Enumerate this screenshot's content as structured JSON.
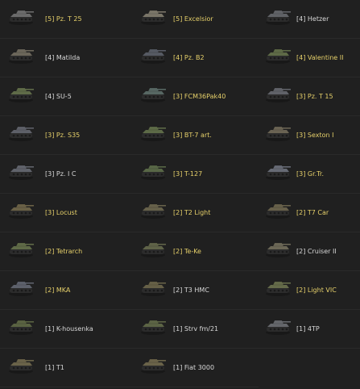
{
  "colors": {
    "background": "#202020",
    "premium_text": "#e6d06a",
    "standard_text": "#d8d8d8"
  },
  "tanks": [
    {
      "label": "[5] Pz. T 25",
      "premium": true,
      "icon": "tank-icon",
      "tint": "#6b6b6b"
    },
    {
      "label": "[5] Excelsior",
      "premium": true,
      "icon": "tank-icon",
      "tint": "#7a7568"
    },
    {
      "label": "[4] Hetzer",
      "premium": false,
      "icon": "tank-icon",
      "tint": "#606266"
    },
    {
      "label": "[4] Matilda",
      "premium": false,
      "icon": "tank-icon",
      "tint": "#6b665a"
    },
    {
      "label": "[4] Pz. B2",
      "premium": true,
      "icon": "tank-icon",
      "tint": "#565a63"
    },
    {
      "label": "[4] Valentine II",
      "premium": true,
      "icon": "tank-icon",
      "tint": "#5e6a47"
    },
    {
      "label": "[4] SU-5",
      "premium": false,
      "icon": "tank-icon",
      "tint": "#5f6b48"
    },
    {
      "label": "[3] FCM36Pak40",
      "premium": true,
      "icon": "tank-icon",
      "tint": "#576763"
    },
    {
      "label": "[3] Pz. T 15",
      "premium": true,
      "icon": "tank-icon",
      "tint": "#606268"
    },
    {
      "label": "[3] Pz. S35",
      "premium": true,
      "icon": "tank-icon",
      "tint": "#5e6068"
    },
    {
      "label": "[3] BT-7 art.",
      "premium": true,
      "icon": "tank-icon",
      "tint": "#5d6a47"
    },
    {
      "label": "[3] Sexton I",
      "premium": true,
      "icon": "tank-icon",
      "tint": "#6a6353"
    },
    {
      "label": "[3] Pz. I C",
      "premium": false,
      "icon": "tank-icon",
      "tint": "#60636b"
    },
    {
      "label": "[3] T-127",
      "premium": true,
      "icon": "tank-icon",
      "tint": "#586746"
    },
    {
      "label": "[3] Gr.Tr.",
      "premium": true,
      "icon": "tank-icon",
      "tint": "#666a74"
    },
    {
      "label": "[3] Locust",
      "premium": true,
      "icon": "tank-icon",
      "tint": "#6a6146"
    },
    {
      "label": "[2] T2 Light",
      "premium": true,
      "icon": "tank-icon",
      "tint": "#66614a"
    },
    {
      "label": "[2] T7 Car",
      "premium": true,
      "icon": "tank-icon",
      "tint": "#67604a"
    },
    {
      "label": "[2] Tetrarch",
      "premium": true,
      "icon": "tank-icon",
      "tint": "#5f6a47"
    },
    {
      "label": "[2] Te-Ke",
      "premium": true,
      "icon": "tank-icon",
      "tint": "#5f6348"
    },
    {
      "label": "[2] Cruiser II",
      "premium": false,
      "icon": "tank-icon",
      "tint": "#6b6756"
    },
    {
      "label": "[2] MKA",
      "premium": true,
      "icon": "tank-icon",
      "tint": "#5d616b"
    },
    {
      "label": "[2] T3 HMC",
      "premium": false,
      "icon": "tank-icon",
      "tint": "#666047"
    },
    {
      "label": "[2] Light VIC",
      "premium": true,
      "icon": "tank-icon",
      "tint": "#656b4a"
    },
    {
      "label": "[1] K-housenka",
      "premium": false,
      "icon": "tank-icon",
      "tint": "#5a6342"
    },
    {
      "label": "[1] Strv fm/21",
      "premium": false,
      "icon": "tank-icon",
      "tint": "#5c6445"
    },
    {
      "label": "[1] 4TP",
      "premium": false,
      "icon": "tank-icon",
      "tint": "#65676b"
    },
    {
      "label": "[1] T1",
      "premium": false,
      "icon": "tank-icon",
      "tint": "#6a6349"
    },
    {
      "label": "[1] Fiat 3000",
      "premium": false,
      "icon": "tank-icon",
      "tint": "#6a6349"
    }
  ]
}
